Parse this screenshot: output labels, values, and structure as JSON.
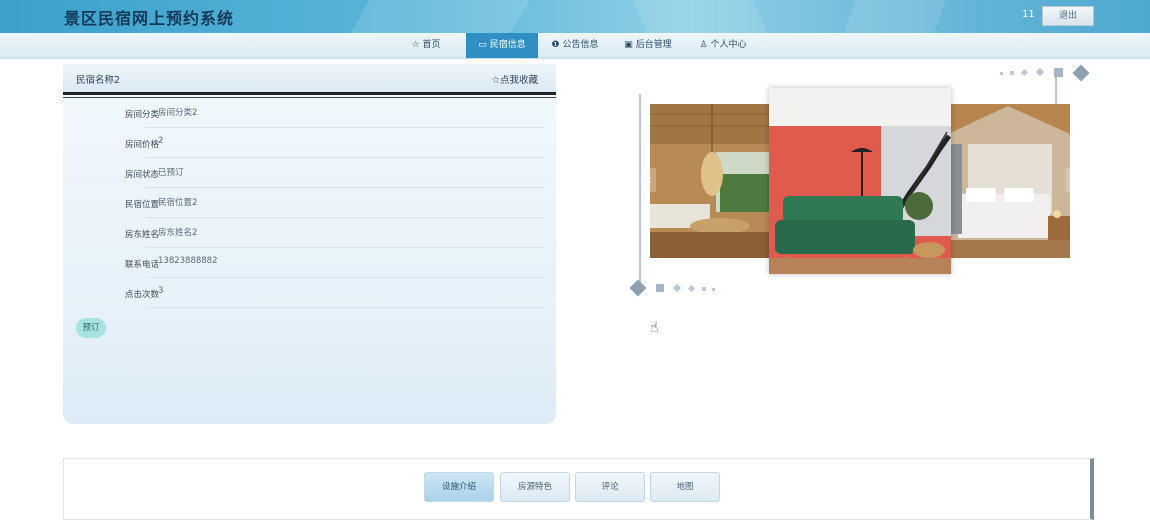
{
  "header": {
    "title": "景区民宿网上预约系统",
    "user": "11",
    "logout_label": "退出"
  },
  "nav": [
    {
      "icon": "☆",
      "icon_name": "home-star-icon",
      "label": "首页"
    },
    {
      "icon": "▭",
      "icon_name": "house-icon",
      "label": "民宿信息",
      "active": true
    },
    {
      "icon": "❶",
      "icon_name": "notice-icon",
      "label": "公告信息"
    },
    {
      "icon": "▣",
      "icon_name": "admin-icon",
      "label": "后台管理"
    },
    {
      "icon": "♙",
      "icon_name": "user-icon",
      "label": "个人中心"
    }
  ],
  "detail": {
    "name": "民宿名称2",
    "favorite_label": "☆点我收藏",
    "rows": [
      {
        "label": "房间分类",
        "value": "房间分类2"
      },
      {
        "label": "房间价格",
        "value": "2"
      },
      {
        "label": "房间状态",
        "value": "已预订"
      },
      {
        "label": "民宿位置",
        "value": "民宿位置2"
      },
      {
        "label": "房东姓名",
        "value": "房东姓名2"
      },
      {
        "label": "联系电话",
        "value": "13823888882"
      },
      {
        "label": "点击次数",
        "value": "3"
      }
    ],
    "book_label": "预订"
  },
  "carousel": {
    "slides": [
      "wooden-interior-photo",
      "red-wall-green-sofa-photo",
      "white-bedroom-photo"
    ],
    "active_index": 1
  },
  "tabs": [
    {
      "label": "设施介绍",
      "active": true
    },
    {
      "label": "房源特色"
    },
    {
      "label": "评论"
    },
    {
      "label": "地图"
    }
  ],
  "colors": {
    "header": "#4ea8d0",
    "nav_active": "#2f8ec2",
    "book_button": "#a9e3df"
  }
}
